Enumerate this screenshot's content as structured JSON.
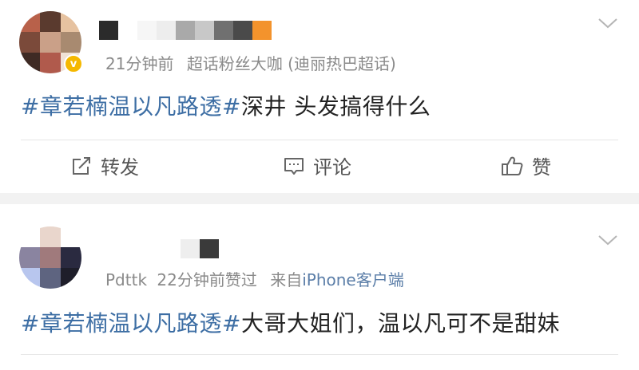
{
  "posts": [
    {
      "meta_time": "21分钟前",
      "meta_rest": "超话粉丝大咖 (迪丽热巴超话)",
      "verified_badge": "v",
      "content_topic": "#章若楠温以凡路透#",
      "content_text": "深井 头发搞得什么",
      "actions": {
        "repost": "转发",
        "comment": "评论",
        "like": "赞"
      }
    },
    {
      "meta_user": "Pdttk",
      "meta_time": "22分钟前赞过",
      "meta_from": "来自",
      "meta_source": "iPhone客户端",
      "content_topic": "#章若楠温以凡路透#",
      "content_text": "大哥大姐们，温以凡可不是甜妹"
    }
  ],
  "colors": {
    "topic_link": "#3d6ea4",
    "meta_gray": "#8a8a8a",
    "badge_gold": "#f5b800",
    "separator": "#f2f2f2"
  },
  "icons": [
    "repost-icon",
    "comment-icon",
    "like-icon",
    "chevron-down-icon",
    "verified-badge-icon"
  ]
}
